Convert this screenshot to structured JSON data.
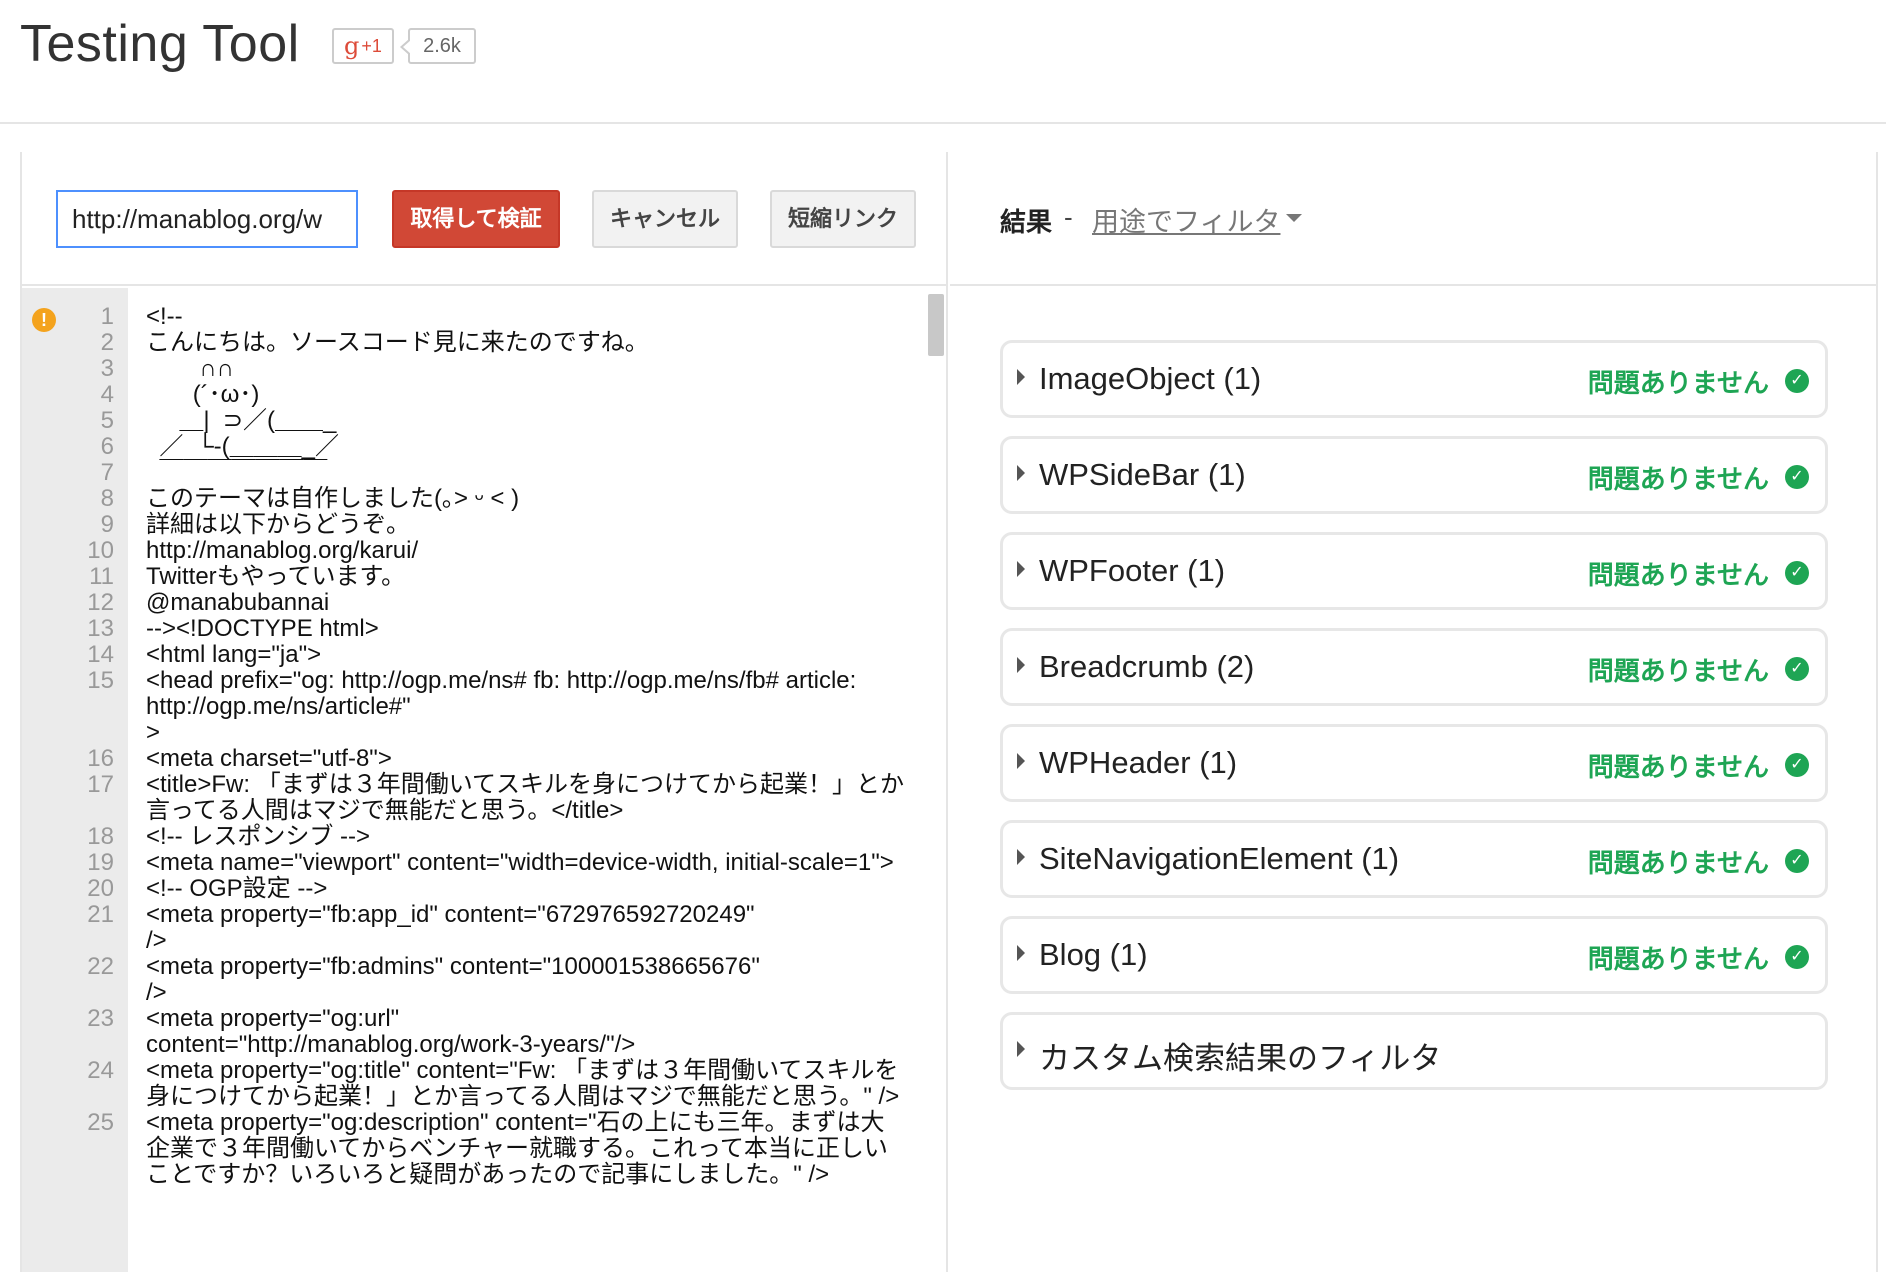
{
  "header": {
    "title": "Testing Tool",
    "gplus_label": "g+1",
    "share_count": "2.6k"
  },
  "toolbar": {
    "url_value": "http://manablog.org/w",
    "fetch_label": "取得して検証",
    "cancel_label": "キャンセル",
    "shortlink_label": "短縮リンク"
  },
  "editor": {
    "warning_line": 1,
    "lines": [
      {
        "n": "1",
        "t": "<!--"
      },
      {
        "n": "2",
        "t": "こんにちは。ソースコード見に来たのですね。"
      },
      {
        "n": "3",
        "t": "        ∩∩"
      },
      {
        "n": "4",
        "t": "       (´･ω･)"
      },
      {
        "n": "5",
        "t": "     ＿|  ⊃／(＿＿_"
      },
      {
        "n": "6",
        "t": "  ／  └-(＿＿＿_／"
      },
      {
        "n": "7",
        "t": "  ￣￣￣￣￣￣￣"
      },
      {
        "n": "8",
        "t": "このテーマは自作しました(｡˃ ᵕ ˂ )"
      },
      {
        "n": "9",
        "t": "詳細は以下からどうぞ。"
      },
      {
        "n": "10",
        "t": "http://manablog.org/karui/"
      },
      {
        "n": "11",
        "t": "Twitterもやっています。"
      },
      {
        "n": "12",
        "t": "@manabubannai"
      },
      {
        "n": "13",
        "t": "--><!DOCTYPE html>"
      },
      {
        "n": "14",
        "t": "<html lang=\"ja\">"
      },
      {
        "n": "15",
        "t": "<head prefix=\"og: http://ogp.me/ns# fb: http://ogp.me/ns/fb# article: http://ogp.me/ns/article#\"\n>"
      },
      {
        "n": "16",
        "t": "<meta charset=\"utf-8\">"
      },
      {
        "n": "17",
        "t": "<title>Fw: 「まずは３年間働いてスキルを身につけてから起業！」とか言ってる人間はマジで無能だと思う。</title>"
      },
      {
        "n": "18",
        "t": "<!-- レスポンシブ -->"
      },
      {
        "n": "19",
        "t": "<meta name=\"viewport\" content=\"width=device-width, initial-scale=1\">"
      },
      {
        "n": "20",
        "t": "<!-- OGP設定 -->"
      },
      {
        "n": "21",
        "t": "<meta property=\"fb:app_id\" content=\"672976592720249\"\n/>"
      },
      {
        "n": "22",
        "t": "<meta property=\"fb:admins\" content=\"100001538665676\"\n/>"
      },
      {
        "n": "23",
        "t": "<meta property=\"og:url\"\ncontent=\"http://manablog.org/work-3-years/\"/>"
      },
      {
        "n": "24",
        "t": "<meta property=\"og:title\" content=\"Fw: 「まずは３年間働いてスキルを身につけてから起業！」とか言ってる人間はマジで無能だと思う。\" />"
      },
      {
        "n": "25",
        "t": "<meta property=\"og:description\" content=\"石の上にも三年。まずは大企業で３年間働いてからベンチャー就職する。これって本当に正しいことですか？いろいろと疑問があったので記事にしました。\" />"
      }
    ]
  },
  "results": {
    "label": "結果",
    "dash": "-",
    "filter_label": "用途でフィルタ",
    "items": [
      {
        "name": "ImageObject (1)",
        "status": "問題ありません"
      },
      {
        "name": "WPSideBar (1)",
        "status": "問題ありません"
      },
      {
        "name": "WPFooter (1)",
        "status": "問題ありません"
      },
      {
        "name": "Breadcrumb (2)",
        "status": "問題ありません"
      },
      {
        "name": "WPHeader (1)",
        "status": "問題ありません"
      },
      {
        "name": "SiteNavigationElement (1)",
        "status": "問題ありません"
      },
      {
        "name": "Blog (1)",
        "status": "問題ありません"
      },
      {
        "name": "カスタム検索結果のフィルタ",
        "status": ""
      }
    ]
  },
  "colors": {
    "fetch_button": "#d14836",
    "ok_green": "#1ea554",
    "input_focus": "#4d90fe",
    "warning": "#f4a31d"
  }
}
